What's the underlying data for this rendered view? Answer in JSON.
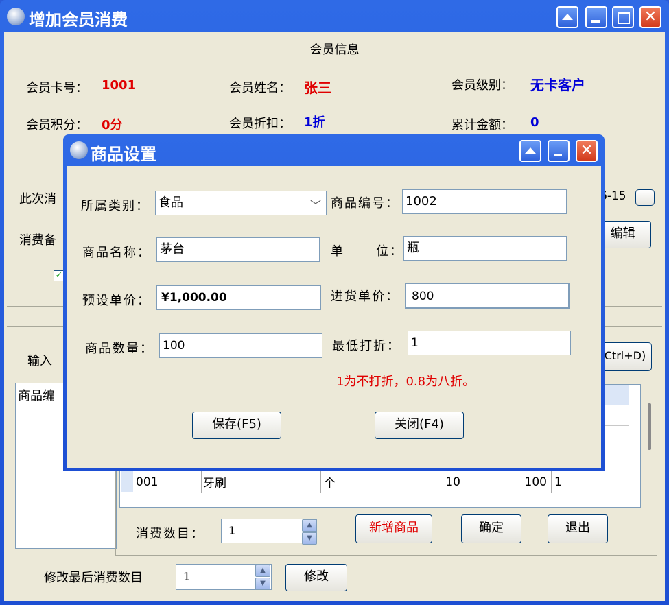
{
  "main_window": {
    "title": "增加会员消费",
    "member_section": {
      "header": "会员信息",
      "card_no_label": "会员卡号：",
      "card_no": "1001",
      "name_label": "会员姓名：",
      "name": "张三",
      "level_label": "会员级别：",
      "level": "无卡客户",
      "points_label": "会员积分：",
      "points": "0分",
      "discount_label": "会员折扣：",
      "discount": "1折",
      "total_label": "累计金额：",
      "total": "0"
    },
    "consume_label_partial": "此次消",
    "date_partial": "6-15",
    "remark_label_partial": "消费备",
    "edit_button": "编辑",
    "input_label_partial": "输入",
    "ctrl_d_button": "Ctrl+D)",
    "left_list_header": "商品编",
    "table": {
      "row": [
        "001",
        "牙刷",
        "个",
        "10",
        "100",
        "1"
      ]
    },
    "consume_count_label": "消费数目：",
    "consume_count_value": "1",
    "add_product_button": "新增商品",
    "confirm_button": "确定",
    "exit_button": "退出",
    "modify_last_label": "修改最后消费数目",
    "modify_last_value": "1",
    "modify_button": "修改"
  },
  "dialog": {
    "title": "商品设置",
    "category_label": "所属类别：",
    "category_value": "食品",
    "code_label": "商品编号：",
    "code_value": "1002",
    "name_label": "商品名称：",
    "name_value": "茅台",
    "unit_label_1": "单",
    "unit_label_2": "位：",
    "unit_value": "瓶",
    "preset_price_label": "预设单价：",
    "preset_price_value": "¥1,000.00",
    "purchase_price_label": "进货单价：",
    "purchase_price_value": "800",
    "quantity_label": "商品数量：",
    "quantity_value": "100",
    "min_discount_label": "最低打折：",
    "min_discount_value": "1",
    "hint": "1为不打折，0.8为八折。",
    "save_button": "保存(F5)",
    "close_button": "关闭(F4)"
  }
}
